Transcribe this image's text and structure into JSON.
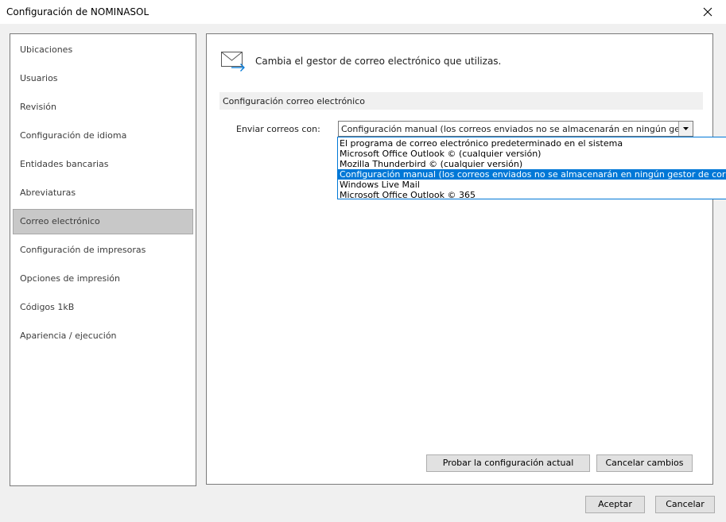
{
  "window": {
    "title": "Configuración de NOMINASOL"
  },
  "sidebar": {
    "items": [
      {
        "label": "Ubicaciones"
      },
      {
        "label": "Usuarios"
      },
      {
        "label": "Revisión"
      },
      {
        "label": "Configuración de idioma"
      },
      {
        "label": "Entidades bancarias"
      },
      {
        "label": "Abreviaturas"
      },
      {
        "label": "Correo electrónico",
        "selected": true
      },
      {
        "label": "Configuración de impresoras"
      },
      {
        "label": "Opciones de impresión"
      },
      {
        "label": "Códigos 1kB"
      },
      {
        "label": "Apariencia / ejecución"
      }
    ]
  },
  "main": {
    "header_text": "Cambia el gestor de correo electrónico que utilizas.",
    "section_title": "Configuración correo electrónico",
    "send_label": "Enviar correos con:",
    "combo_value": "Configuración manual (los correos enviados no se almacenarán en ningún gestor de correo)",
    "options": [
      "El programa de correo electrónico predeterminado en el sistema",
      "Microsoft Office Outlook © (cualquier versión)",
      "Mozilla Thunderbird © (cualquier versión)",
      "Configuración manual (los correos enviados no se almacenarán en ningún gestor de correo)",
      "Windows Live Mail",
      "Microsoft Office Outlook © 365"
    ],
    "selected_option": "Configuración manual (los correos enviados no se almacenarán en ningún gestor de correo)",
    "test_button": "Probar la configuración actual",
    "cancel_changes_button": "Cancelar cambios"
  },
  "footer": {
    "accept_button": "Aceptar",
    "cancel_button": "Cancelar"
  },
  "colors": {
    "accent": "#0078d7",
    "selected_sidebar": "#c8c8c8",
    "window_bg": "#f0f0f0"
  },
  "icons": {
    "close": "close-icon",
    "header": "mail-forward-icon",
    "dropdown": "chevron-down-icon"
  }
}
